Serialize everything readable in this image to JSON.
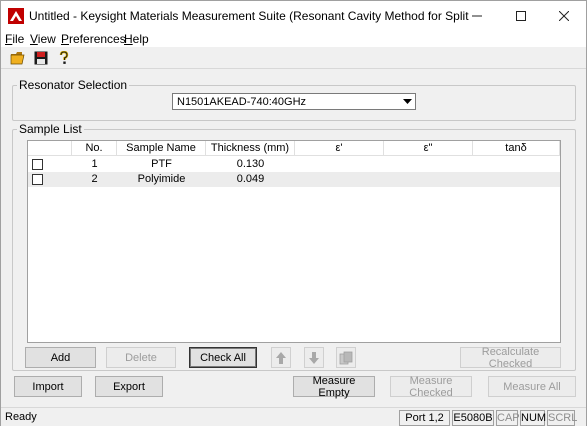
{
  "window": {
    "title": "Untitled - Keysight Materials Measurement Suite (Resonant Cavity Method for Split Cylind...",
    "minimize_glyph": "—",
    "maximize_glyph": "☐",
    "close_glyph": "✕"
  },
  "menu": {
    "items": [
      {
        "first": "F",
        "rest": "ile"
      },
      {
        "first": "V",
        "rest": "iew"
      },
      {
        "first": "P",
        "rest": "references"
      },
      {
        "first": "H",
        "rest": "elp"
      }
    ]
  },
  "toolbar": {
    "icons": [
      "open-folder-icon",
      "save-disk-icon",
      "help-question-icon"
    ]
  },
  "resonator": {
    "group_title": "Resonator Selection",
    "selected": "N1501AKEAD-740:40GHz"
  },
  "samples": {
    "group_title": "Sample List",
    "columns": [
      "No.",
      "Sample Name",
      "Thickness (mm)",
      "ε'",
      "ε\"",
      "tanδ"
    ],
    "rows": [
      {
        "checked": false,
        "no": "1",
        "name": "PTF",
        "thickness": "0.130",
        "eps_real": "",
        "eps_imag": "",
        "tan_delta": ""
      },
      {
        "checked": false,
        "no": "2",
        "name": "Polyimide",
        "thickness": "0.049",
        "eps_real": "",
        "eps_imag": "",
        "tan_delta": ""
      }
    ],
    "buttons": {
      "add": "Add",
      "delete": "Delete",
      "check_all": "Check All",
      "recalculate": "Recalculate Checked"
    }
  },
  "bottom": {
    "import": "Import",
    "export": "Export",
    "measure_empty": "Measure Empty",
    "measure_checked": "Measure Checked",
    "measure_all": "Measure All"
  },
  "status": {
    "text": "Ready",
    "port": "Port 1,2",
    "instrument": "E5080B",
    "cap": "CAP",
    "num": "NUM",
    "scrl": "SCRL"
  },
  "colors": {
    "disabled_text": "#9c9c9c",
    "row_alt": "#ececec",
    "window_bg": "#f0f0f0"
  }
}
